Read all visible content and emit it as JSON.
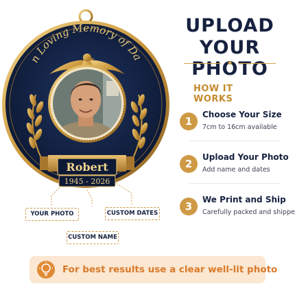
{
  "ornament": {
    "arc_text": "In Loving Memory of Dad",
    "name": "Robert",
    "dates": "1945 - 2026"
  },
  "header": {
    "title_line1": "UPLOAD",
    "title_line2": "YOUR PHOTO",
    "divider_icon": "diamond-star-icon"
  },
  "how_it_works": {
    "heading": "HOW IT WORKS",
    "steps": [
      {
        "number": "1",
        "title": "Choose Your Size",
        "desc": "7cm to 16cm available"
      },
      {
        "number": "2",
        "title": "Upload Your Photo",
        "desc": "Add name and dates"
      },
      {
        "number": "3",
        "title": "We Print and Ship",
        "desc": "Carefully packed and shipped"
      }
    ]
  },
  "callouts": {
    "photo": "YOUR PHOTO",
    "dates": "CUSTOM DATES",
    "name": "CUSTOM NAME"
  },
  "banner": {
    "icon": "lightbulb-icon",
    "text": "For best results use a clear well-lit photo"
  },
  "colors": {
    "navy": "#16213f",
    "gold": "#d4a447",
    "accent_orange": "#d97a2a",
    "banner_bg": "#fbe7d2"
  }
}
